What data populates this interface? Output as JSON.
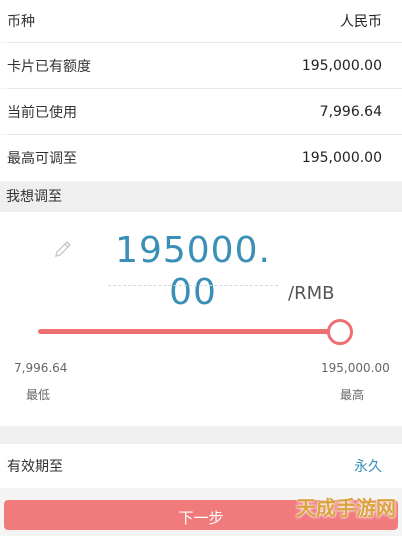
{
  "info_rows": [
    {
      "label": "币种",
      "value": "人民币"
    },
    {
      "label": "卡片已有额度",
      "value": "195,000.00"
    },
    {
      "label": "当前已使用",
      "value": "7,996.64"
    },
    {
      "label": "最高可调至",
      "value": "195,000.00"
    }
  ],
  "adjust": {
    "title": "我想调至",
    "amount": "195000.00",
    "unit": "/RMB",
    "slider": {
      "min_value": "7,996.64",
      "min_label": "最低",
      "max_value": "195,000.00",
      "max_label": "最高",
      "position": 1.0
    }
  },
  "expiry": {
    "label": "有效期至",
    "value": "永久"
  },
  "next_button": {
    "label": "下一步"
  },
  "watermark": "天成手游网",
  "colors": {
    "accent_red": "#ef7072",
    "accent_blue": "#3a8fb7"
  }
}
